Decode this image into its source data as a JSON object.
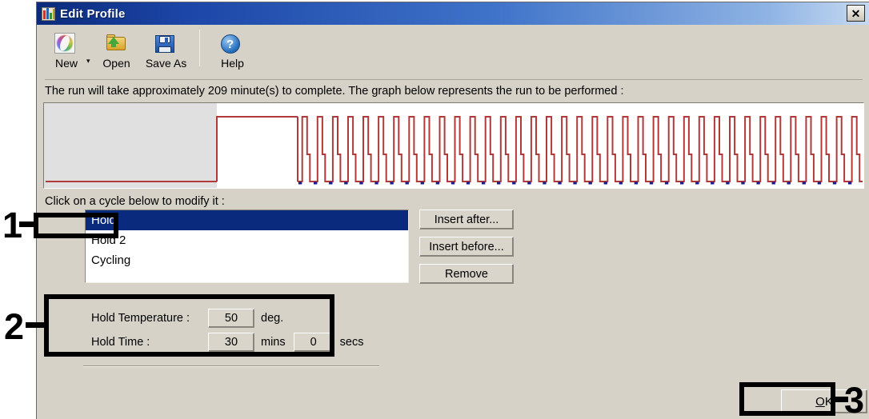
{
  "window": {
    "title": "Edit Profile",
    "title_icon": "profile-chart-icon",
    "close_label": "✕"
  },
  "toolbar": {
    "items": [
      {
        "label": "New",
        "icon": "new-profile-icon"
      },
      {
        "label": "Open",
        "icon": "open-folder-icon"
      },
      {
        "label": "Save As",
        "icon": "floppy-disk-icon"
      },
      {
        "label": "Help",
        "icon": "help-question-icon"
      }
    ],
    "new_dropdown_caret": "▾"
  },
  "info": {
    "run_text": "The run will take approximately 209 minute(s) to complete. The graph below represents the run to be performed :"
  },
  "graph": {
    "description": "Thermal cycler temperature profile: Hold segment (selected, grey background) at low temperature, Hold 2 plateau at high temperature, then repeated cycling spikes with blue acquisition markers",
    "line_color": "#b03a3a",
    "acquire_color": "#1a1a8c",
    "selection_bg": "#e0e0e0",
    "plot_bg": "#ffffff",
    "cycles": 37
  },
  "list_section": {
    "caption": "Click on a cycle below to modify it :",
    "cycles": [
      {
        "label": "Hold",
        "selected": true
      },
      {
        "label": "Hold 2",
        "selected": false
      },
      {
        "label": "Cycling",
        "selected": false
      }
    ],
    "buttons": [
      {
        "label": "Insert after..."
      },
      {
        "label": "Insert before..."
      },
      {
        "label": "Remove"
      }
    ]
  },
  "parameters": {
    "temperature_label": "Hold Temperature :",
    "temperature_value": "50",
    "temperature_unit": "deg.",
    "time_label": "Hold Time :",
    "minutes_value": "30",
    "minutes_unit": "mins",
    "seconds_value": "0",
    "seconds_unit": "secs"
  },
  "footer": {
    "ok_accel": "O",
    "ok_rest": "K"
  },
  "annotations": [
    {
      "number": "1",
      "target": "selected-cycle-hold"
    },
    {
      "number": "2",
      "target": "hold-parameters-panel"
    },
    {
      "number": "3",
      "target": "ok-button"
    }
  ]
}
